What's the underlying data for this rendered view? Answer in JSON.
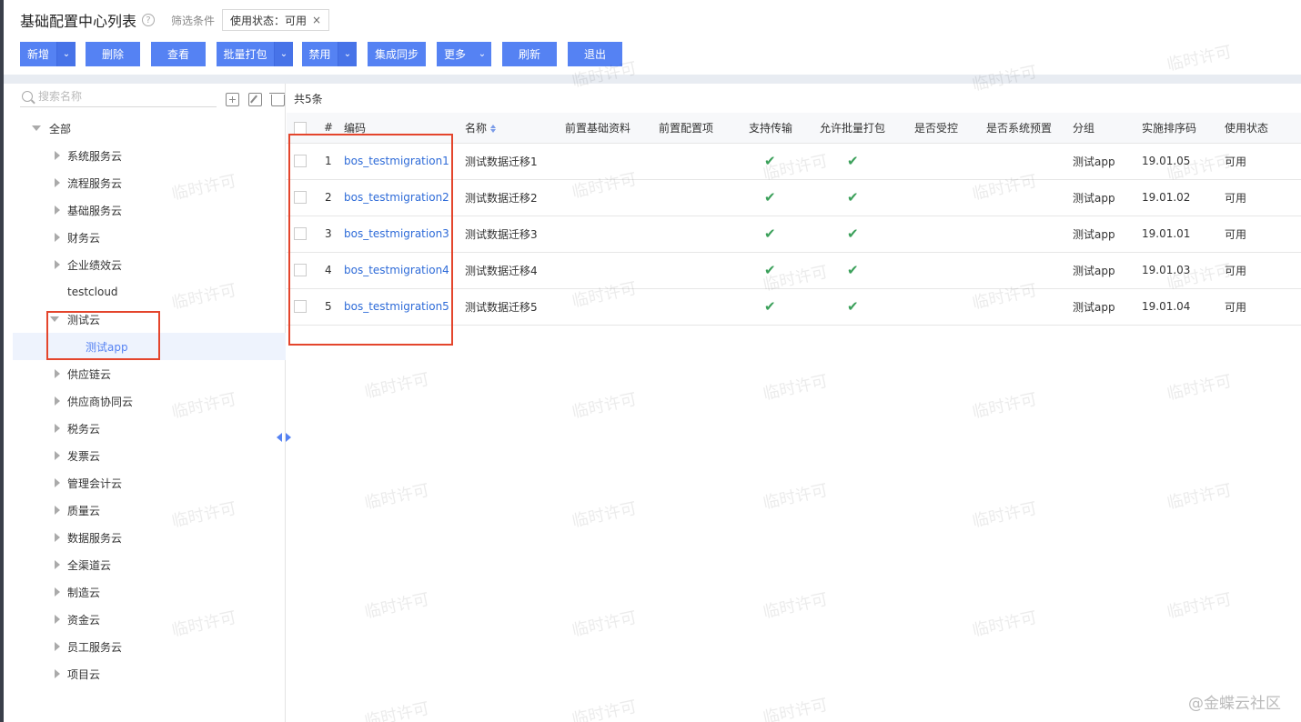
{
  "header": {
    "title": "基础配置中心列表",
    "help_icon": "?",
    "filter_label": "筛选条件",
    "filter_tag": "使用状态：可用",
    "filter_close": "×"
  },
  "toolbar": {
    "new": "新增",
    "delete": "删除",
    "view": "查看",
    "batch_pack": "批量打包",
    "disable": "禁用",
    "sync": "集成同步",
    "more": "更多",
    "refresh": "刷新",
    "exit": "退出",
    "dropdown_glyph": "⌄"
  },
  "search": {
    "placeholder": "搜索名称"
  },
  "tree": {
    "root": "全部",
    "nodes": [
      "系统服务云",
      "流程服务云",
      "基础服务云",
      "财务云",
      "企业绩效云",
      "testcloud",
      "测试云",
      "测试app",
      "供应链云",
      "供应商协同云",
      "税务云",
      "发票云",
      "管理会计云",
      "质量云",
      "数据服务云",
      "全渠道云",
      "制造云",
      "资金云",
      "员工服务云",
      "项目云"
    ]
  },
  "grid": {
    "count_text": "共5条",
    "columns": [
      "#",
      "编码",
      "名称",
      "前置基础资料",
      "前置配置项",
      "支持传输",
      "允许批量打包",
      "是否受控",
      "是否系统预置",
      "分组",
      "实施排序码",
      "使用状态"
    ],
    "rows": [
      {
        "index": "1",
        "code": "bos_testmigration1",
        "name": "测试数据迁移1",
        "group": "测试app",
        "sort_code": "19.01.05",
        "status": "可用"
      },
      {
        "index": "2",
        "code": "bos_testmigration2",
        "name": "测试数据迁移2",
        "group": "测试app",
        "sort_code": "19.01.02",
        "status": "可用"
      },
      {
        "index": "3",
        "code": "bos_testmigration3",
        "name": "测试数据迁移3",
        "group": "测试app",
        "sort_code": "19.01.01",
        "status": "可用"
      },
      {
        "index": "4",
        "code": "bos_testmigration4",
        "name": "测试数据迁移4",
        "group": "测试app",
        "sort_code": "19.01.03",
        "status": "可用"
      },
      {
        "index": "5",
        "code": "bos_testmigration5",
        "name": "测试数据迁移5",
        "group": "测试app",
        "sort_code": "19.01.04",
        "status": "可用"
      }
    ],
    "check_glyph": "✔"
  },
  "watermark": "临时许可",
  "brand": "@金蝶云社区",
  "colors": {
    "accent": "#5582f3",
    "highlight": "#e4452c",
    "check": "#3ba05a",
    "link": "#2e6bd8"
  }
}
